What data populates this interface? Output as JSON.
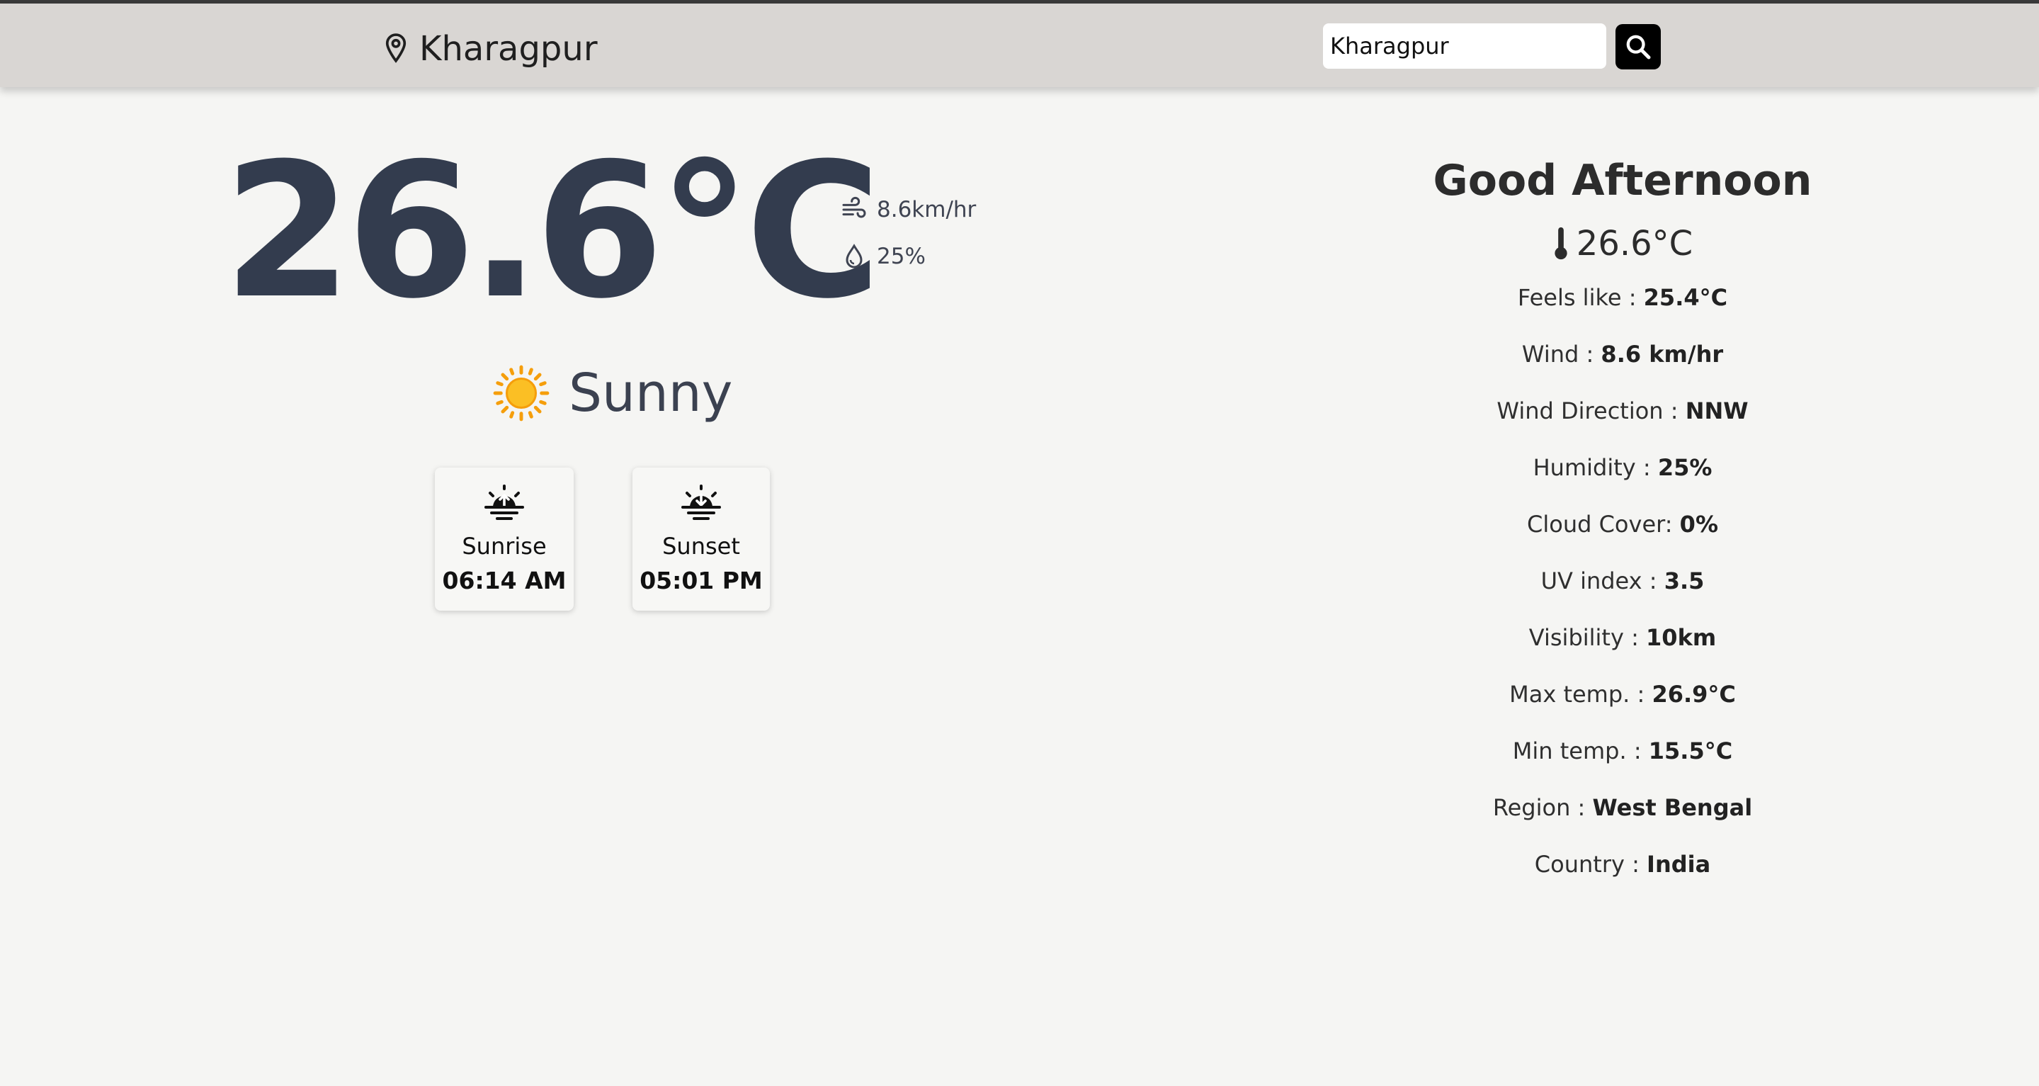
{
  "header": {
    "location": "Kharagpur",
    "search_value": "Kharagpur",
    "location_icon": "map-pin-icon",
    "search_icon": "search-icon"
  },
  "current": {
    "temperature": "26.6°C",
    "wind": "8.6km/hr",
    "humidity": "25%",
    "condition": "Sunny",
    "condition_icon": "sun-icon"
  },
  "sun_times": [
    {
      "label": "Sunrise",
      "time": "06:14 AM",
      "icon": "sunrise-icon"
    },
    {
      "label": "Sunset",
      "time": "05:01 PM",
      "icon": "sunset-icon"
    }
  ],
  "details": {
    "greeting": "Good Afternoon",
    "temperature": "26.6°C",
    "stats": [
      {
        "label": "Feels like : ",
        "value": "25.4°C"
      },
      {
        "label": "Wind : ",
        "value": "8.6 km/hr"
      },
      {
        "label": "Wind Direction : ",
        "value": "NNW"
      },
      {
        "label": "Humidity : ",
        "value": "25%"
      },
      {
        "label": "Cloud Cover: ",
        "value": "0%"
      },
      {
        "label": "UV index : ",
        "value": "3.5"
      },
      {
        "label": "Visibility : ",
        "value": "10km"
      },
      {
        "label": "Max temp. : ",
        "value": "26.9°C"
      },
      {
        "label": "Min temp. : ",
        "value": "15.5°C"
      },
      {
        "label": "Region : ",
        "value": "West Bengal"
      },
      {
        "label": "Country : ",
        "value": "India"
      }
    ]
  },
  "colors": {
    "background": "#f5f5f3",
    "header": "#d9d6d3",
    "temperature": "#333c4e",
    "sun": "#fbbf24"
  }
}
